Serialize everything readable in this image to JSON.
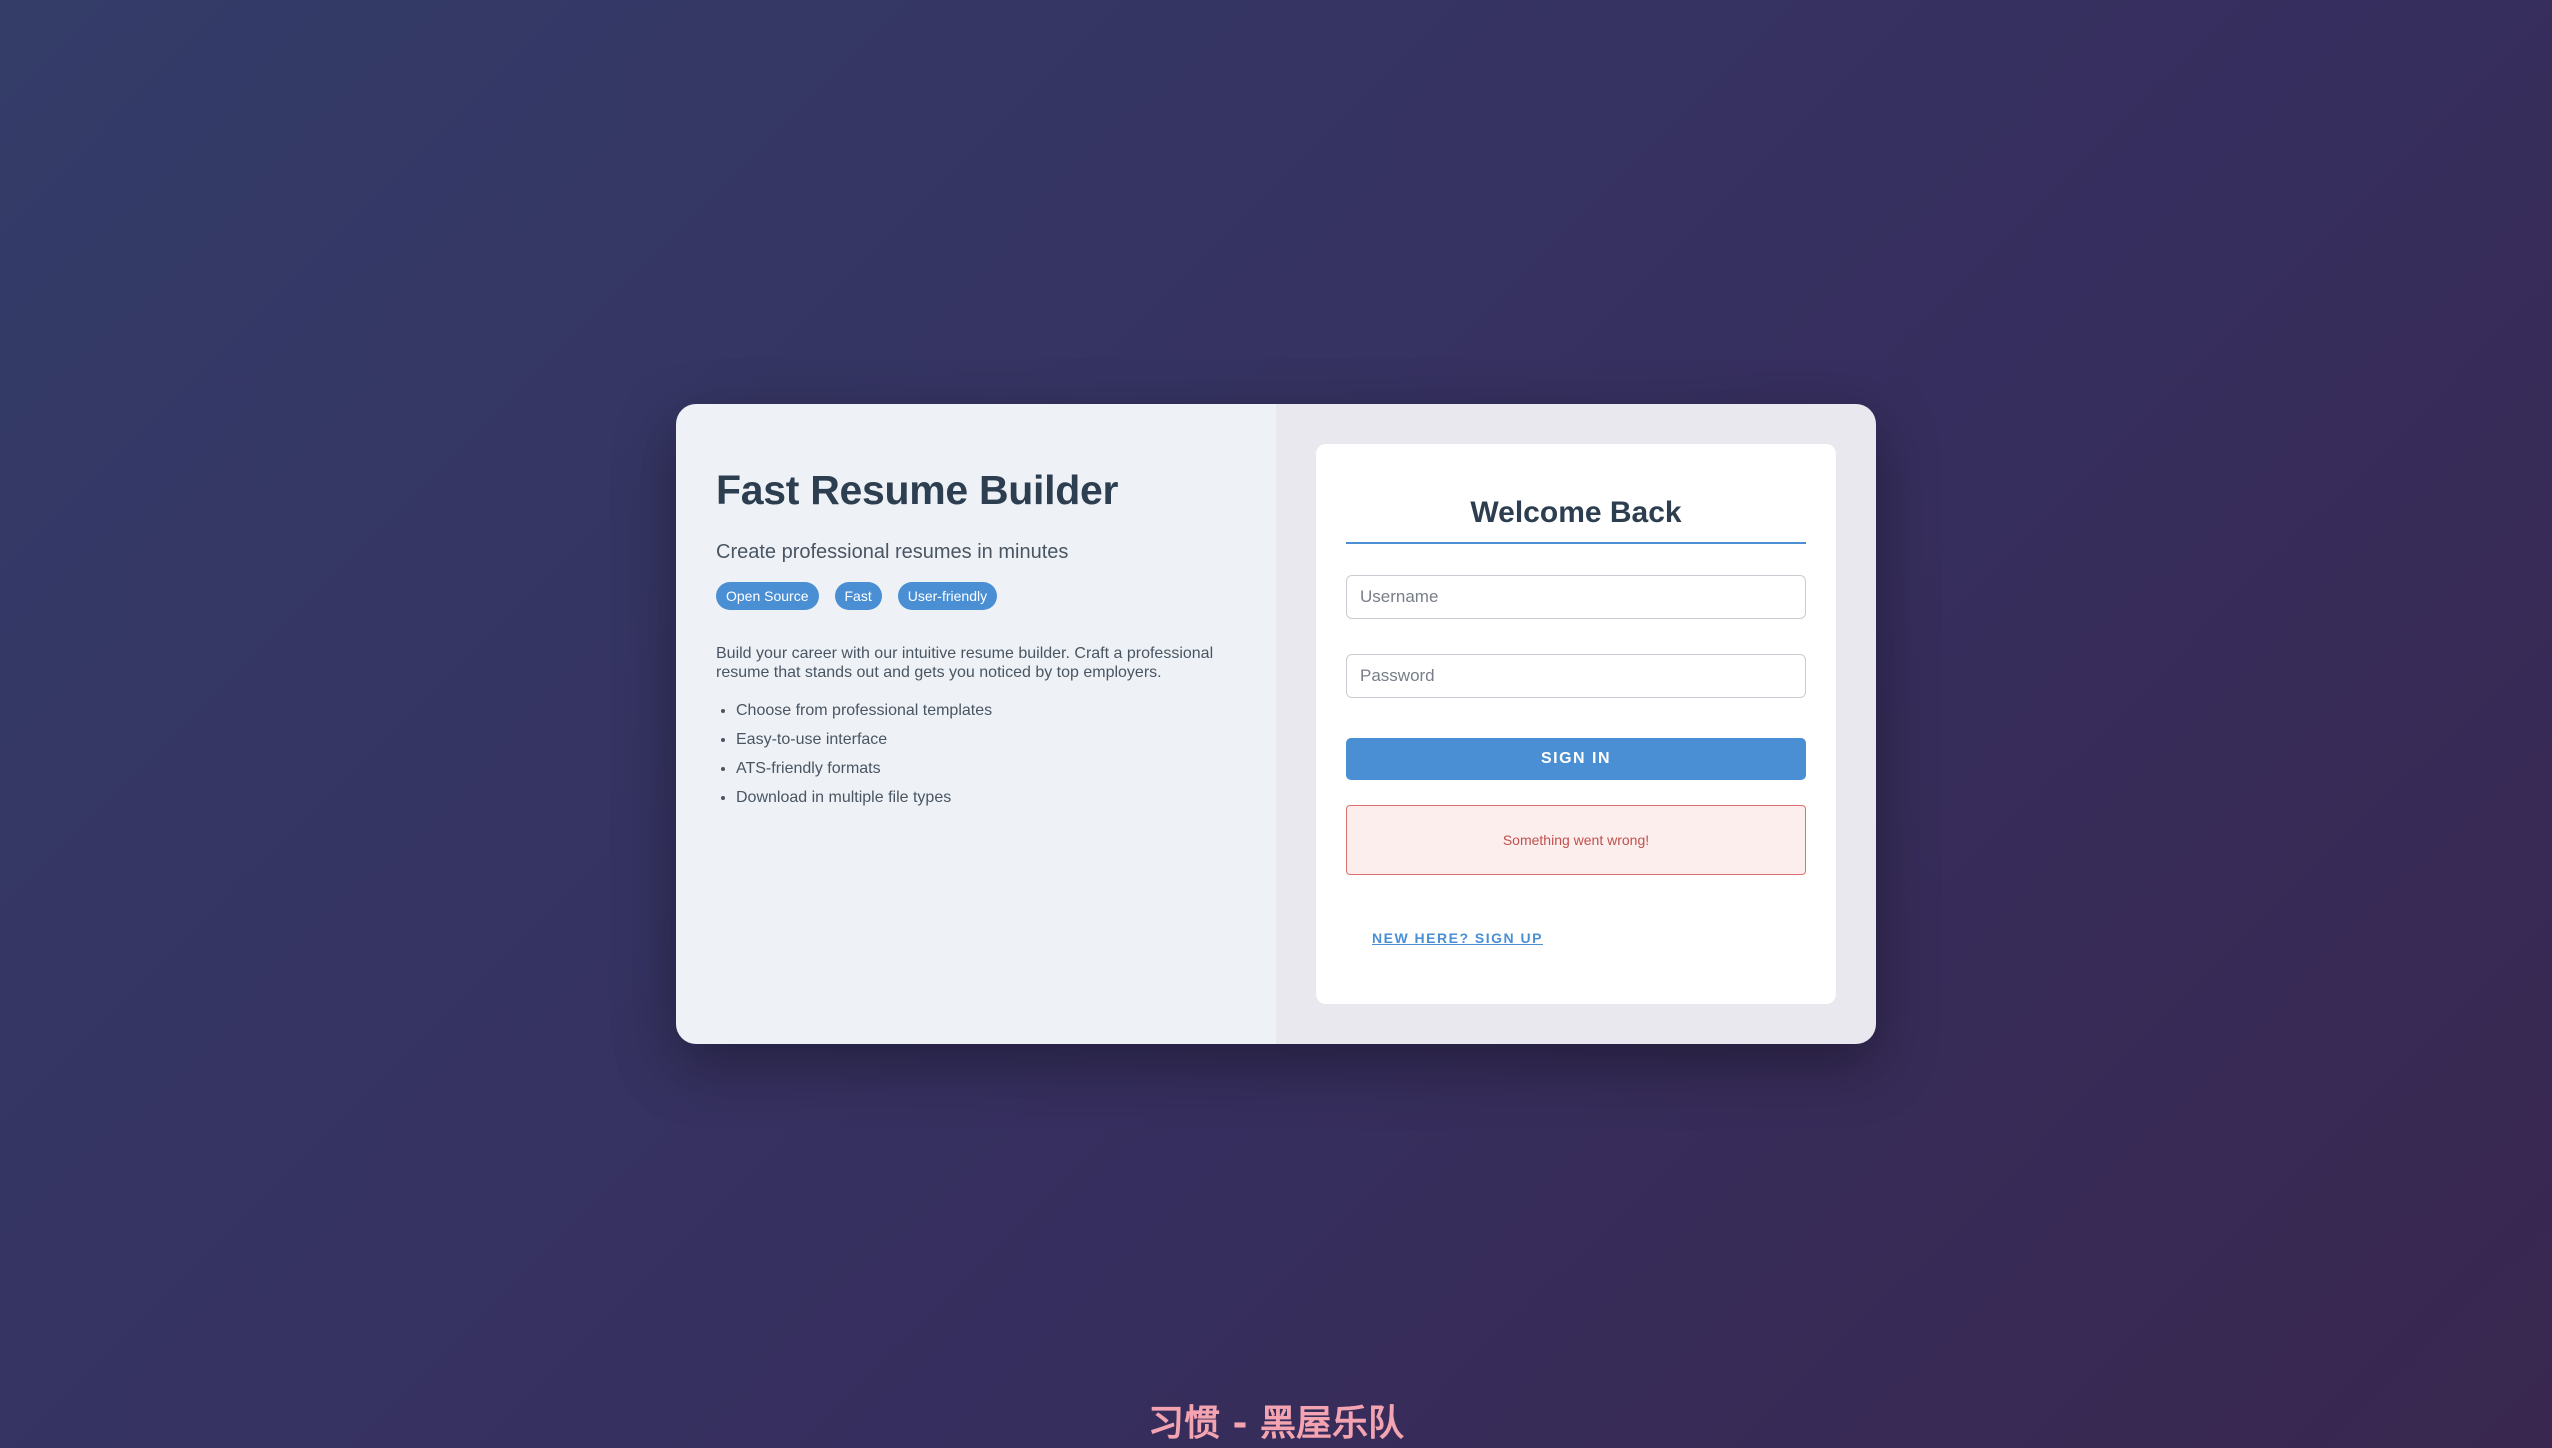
{
  "app": {
    "title": "Fast Resume Builder",
    "subtitle": "Create professional resumes in minutes",
    "tags": [
      "Open Source",
      "Fast",
      "User-friendly"
    ],
    "description": "Build your career with our intuitive resume builder. Craft a professional resume that stands out and gets you noticed by top employers.",
    "features": [
      "Choose from professional templates",
      "Easy-to-use interface",
      "ATS-friendly formats",
      "Download in multiple file types"
    ]
  },
  "login": {
    "heading": "Welcome Back",
    "username_placeholder": "Username",
    "username_value": "",
    "password_placeholder": "Password",
    "password_value": "",
    "signin_label": "SIGN IN",
    "error_message": "Something went wrong!",
    "signup_link": "NEW HERE? SIGN UP"
  },
  "footer": {
    "text": "习惯 - 黑屋乐队"
  },
  "colors": {
    "accent": "#4a8fd4",
    "error": "#c0504d",
    "background_start": "#343c68",
    "background_end": "#39274f"
  }
}
